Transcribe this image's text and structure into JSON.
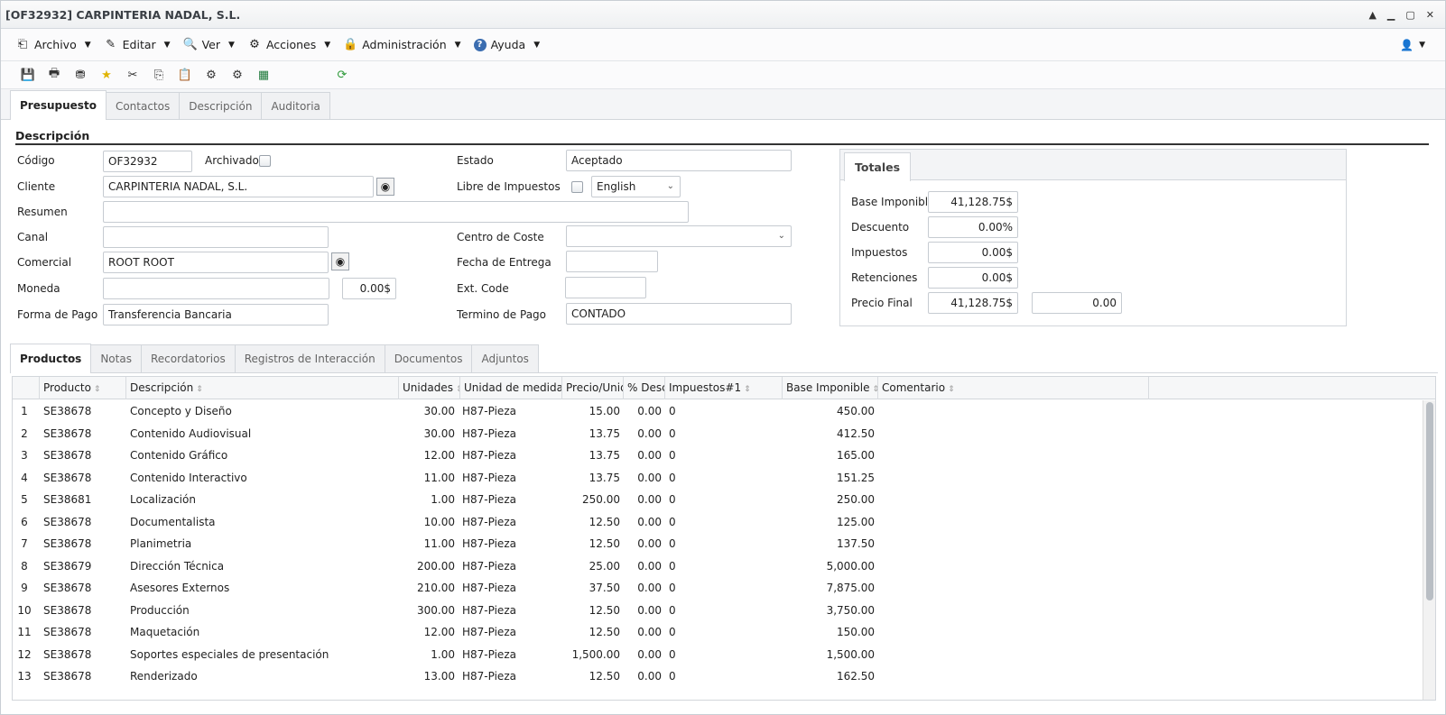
{
  "window": {
    "title": "[OF32932] CARPINTERIA NADAL, S.L."
  },
  "menus": [
    {
      "label": "Archivo",
      "icon": "archive-icon",
      "glyph": "⎗"
    },
    {
      "label": "Editar",
      "icon": "edit-icon",
      "glyph": "✎"
    },
    {
      "label": "Ver",
      "icon": "view-icon",
      "glyph": "🔍"
    },
    {
      "label": "Acciones",
      "icon": "actions-icon",
      "glyph": "⚙"
    },
    {
      "label": "Administración",
      "icon": "lock-icon",
      "glyph": "🔒"
    },
    {
      "label": "Ayuda",
      "icon": "help-icon",
      "glyph": "?"
    }
  ],
  "tabs": [
    "Presupuesto",
    "Contactos",
    "Descripción",
    "Auditoria"
  ],
  "section": {
    "title": "Descripción"
  },
  "form": {
    "codigo_label": "Código",
    "codigo": "OF32932",
    "archivado_label": "Archivado",
    "cliente_label": "Cliente",
    "cliente": "CARPINTERIA NADAL, S.L.",
    "resumen_label": "Resumen",
    "resumen": "",
    "canal_label": "Canal",
    "canal": "",
    "comercial_label": "Comercial",
    "comercial": "ROOT ROOT",
    "moneda_label": "Moneda",
    "moneda": "",
    "moneda_amount": "0.00$",
    "forma_pago_label": "Forma de Pago",
    "forma_pago": "Transferencia Bancaria",
    "estado_label": "Estado",
    "estado": "Aceptado",
    "libre_label": "Libre de Impuestos",
    "idioma": "English",
    "centro_label": "Centro de Coste",
    "centro": "",
    "fecha_label": "Fecha de Entrega",
    "fecha": "",
    "ext_label": "Ext. Code",
    "ext": "",
    "termino_label": "Termino de Pago",
    "termino": "CONTADO"
  },
  "totals": {
    "tab": "Totales",
    "base_label": "Base Imponible",
    "base": "41,128.75$",
    "descuento_label": "Descuento",
    "descuento": "0.00%",
    "impuestos_label": "Impuestos",
    "impuestos": "0.00$",
    "retenciones_label": "Retenciones",
    "retenciones": "0.00$",
    "precio_label": "Precio Final",
    "precio": "41,128.75$",
    "precio_extra": "0.00"
  },
  "bottom_tabs": [
    "Productos",
    "Notas",
    "Recordatorios",
    "Registros de Interacción",
    "Documentos",
    "Adjuntos"
  ],
  "grid": {
    "headers": [
      "Producto",
      "Descripción",
      "Unidades",
      "Unidad de medida",
      "Precio/Unida",
      "% Desc",
      "Impuestos#1",
      "Base Imponible",
      "Comentario"
    ],
    "rows": [
      [
        "1",
        "SE38678",
        "Concepto y Diseño",
        "30.00",
        "H87-Pieza",
        "15.00",
        "0.00",
        "0",
        "450.00"
      ],
      [
        "2",
        "SE38678",
        "Contenido Audiovisual",
        "30.00",
        "H87-Pieza",
        "13.75",
        "0.00",
        "0",
        "412.50"
      ],
      [
        "3",
        "SE38678",
        "Contenido Gráfico",
        "12.00",
        "H87-Pieza",
        "13.75",
        "0.00",
        "0",
        "165.00"
      ],
      [
        "4",
        "SE38678",
        "Contenido Interactivo",
        "11.00",
        "H87-Pieza",
        "13.75",
        "0.00",
        "0",
        "151.25"
      ],
      [
        "5",
        "SE38681",
        "Localización",
        "1.00",
        "H87-Pieza",
        "250.00",
        "0.00",
        "0",
        "250.00"
      ],
      [
        "6",
        "SE38678",
        "Documentalista",
        "10.00",
        "H87-Pieza",
        "12.50",
        "0.00",
        "0",
        "125.00"
      ],
      [
        "7",
        "SE38678",
        "Planimetria",
        "11.00",
        "H87-Pieza",
        "12.50",
        "0.00",
        "0",
        "137.50"
      ],
      [
        "8",
        "SE38679",
        "Dirección Técnica",
        "200.00",
        "H87-Pieza",
        "25.00",
        "0.00",
        "0",
        "5,000.00"
      ],
      [
        "9",
        "SE38678",
        "Asesores Externos",
        "210.00",
        "H87-Pieza",
        "37.50",
        "0.00",
        "0",
        "7,875.00"
      ],
      [
        "10",
        "SE38678",
        "Producción",
        "300.00",
        "H87-Pieza",
        "12.50",
        "0.00",
        "0",
        "3,750.00"
      ],
      [
        "11",
        "SE38678",
        "Maquetación",
        "12.00",
        "H87-Pieza",
        "12.50",
        "0.00",
        "0",
        "150.00"
      ],
      [
        "12",
        "SE38678",
        "Soportes especiales de presentación",
        "1.00",
        "H87-Pieza",
        "1,500.00",
        "0.00",
        "0",
        "1,500.00"
      ],
      [
        "13",
        "SE38678",
        "Renderizado",
        "13.00",
        "H87-Pieza",
        "12.50",
        "0.00",
        "0",
        "162.50"
      ]
    ]
  }
}
